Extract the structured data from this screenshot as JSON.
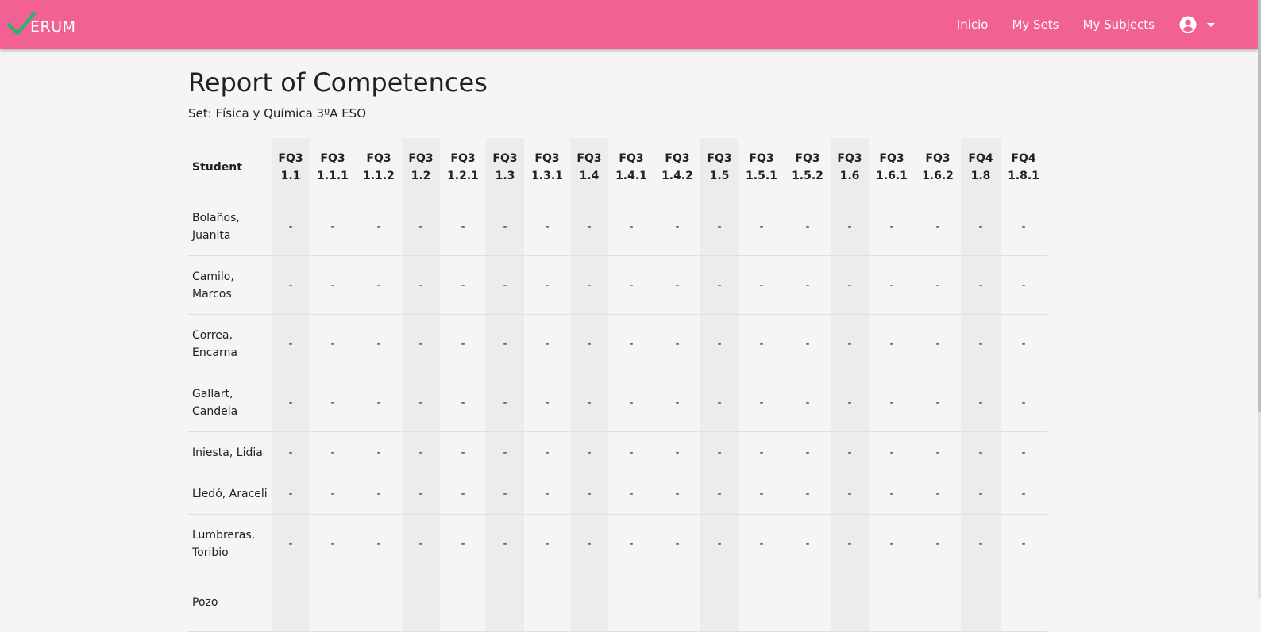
{
  "navbar": {
    "brand_text": "ERUM",
    "links": [
      "Inicio",
      "My Sets",
      "My Subjects"
    ],
    "account_icon": "account-circle-icon",
    "dropdown_icon": "caret-down-icon",
    "colors": {
      "bar": "#f26193",
      "check": "#1db86a"
    }
  },
  "page": {
    "title": "Report of Competences",
    "set_label": "Set: Física y Química 3ºA ESO"
  },
  "table": {
    "student_header": "Student",
    "columns": [
      [
        "FQ3",
        "1.1"
      ],
      [
        "FQ3",
        "1.1.1"
      ],
      [
        "FQ3",
        "1.1.2"
      ],
      [
        "FQ3",
        "1.2"
      ],
      [
        "FQ3",
        "1.2.1"
      ],
      [
        "FQ3",
        "1.3"
      ],
      [
        "FQ3",
        "1.3.1"
      ],
      [
        "FQ3",
        "1.4"
      ],
      [
        "FQ3",
        "1.4.1"
      ],
      [
        "FQ3",
        "1.4.2"
      ],
      [
        "FQ3",
        "1.5"
      ],
      [
        "FQ3",
        "1.5.1"
      ],
      [
        "FQ3",
        "1.5.2"
      ],
      [
        "FQ3",
        "1.6"
      ],
      [
        "FQ3",
        "1.6.1"
      ],
      [
        "FQ3",
        "1.6.2"
      ],
      [
        "FQ4",
        "1.8"
      ],
      [
        "FQ4",
        "1.8.1"
      ]
    ],
    "rows": [
      {
        "student": "Bolaños, Juanita",
        "values": [
          "-",
          "-",
          "-",
          "-",
          "-",
          "-",
          "-",
          "-",
          "-",
          "-",
          "-",
          "-",
          "-",
          "-",
          "-",
          "-",
          "-",
          "-"
        ]
      },
      {
        "student": "Camilo, Marcos",
        "values": [
          "-",
          "-",
          "-",
          "-",
          "-",
          "-",
          "-",
          "-",
          "-",
          "-",
          "-",
          "-",
          "-",
          "-",
          "-",
          "-",
          "-",
          "-"
        ]
      },
      {
        "student": "Correa, Encarna",
        "values": [
          "-",
          "-",
          "-",
          "-",
          "-",
          "-",
          "-",
          "-",
          "-",
          "-",
          "-",
          "-",
          "-",
          "-",
          "-",
          "-",
          "-",
          "-"
        ]
      },
      {
        "student": "Gallart, Candela",
        "values": [
          "-",
          "-",
          "-",
          "-",
          "-",
          "-",
          "-",
          "-",
          "-",
          "-",
          "-",
          "-",
          "-",
          "-",
          "-",
          "-",
          "-",
          "-"
        ]
      },
      {
        "student": "Iniesta, Lidia",
        "values": [
          "-",
          "-",
          "-",
          "-",
          "-",
          "-",
          "-",
          "-",
          "-",
          "-",
          "-",
          "-",
          "-",
          "-",
          "-",
          "-",
          "-",
          "-"
        ]
      },
      {
        "student": "Lledó, Araceli",
        "values": [
          "-",
          "-",
          "-",
          "-",
          "-",
          "-",
          "-",
          "-",
          "-",
          "-",
          "-",
          "-",
          "-",
          "-",
          "-",
          "-",
          "-",
          "-"
        ]
      },
      {
        "student": "Lumbreras, Toribio",
        "values": [
          "-",
          "-",
          "-",
          "-",
          "-",
          "-",
          "-",
          "-",
          "-",
          "-",
          "-",
          "-",
          "-",
          "-",
          "-",
          "-",
          "-",
          "-"
        ]
      },
      {
        "student": "Pozo",
        "values": [
          "",
          "",
          "",
          "",
          "",
          "",
          "",
          "",
          "",
          "",
          "",
          "",
          "",
          "",
          "",
          "",
          "",
          ""
        ]
      }
    ]
  }
}
